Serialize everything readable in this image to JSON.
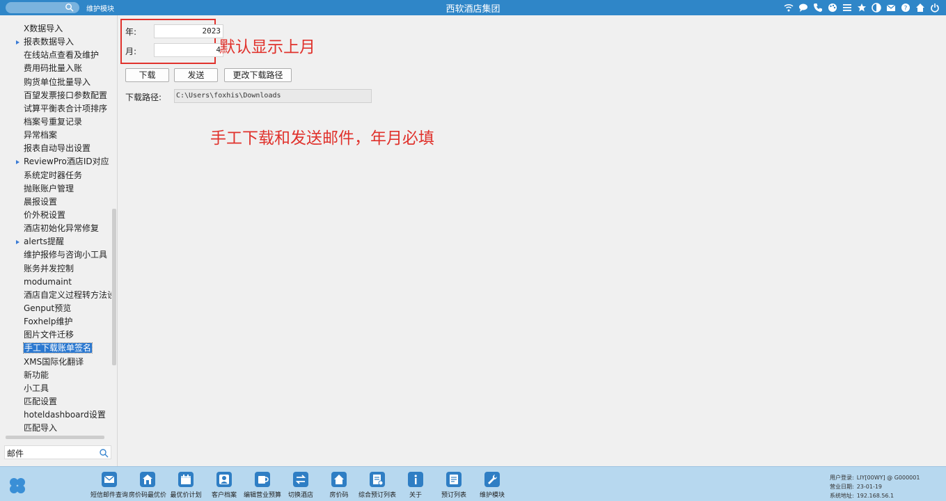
{
  "topbar": {
    "module_name": "维护模块",
    "app_title": "西软酒店集团",
    "icons": [
      "wifi-icon",
      "message-icon",
      "phone-icon",
      "palette-icon",
      "menu-icon",
      "star-icon",
      "theme-icon",
      "mail-icon",
      "help-icon",
      "home-icon",
      "power-icon"
    ]
  },
  "sidebar": {
    "items": [
      {
        "label": "X数据导入",
        "expandable": false
      },
      {
        "label": "报表数据导入",
        "expandable": true
      },
      {
        "label": "在线站点查看及维护",
        "expandable": false
      },
      {
        "label": "费用码批量入账",
        "expandable": false
      },
      {
        "label": "购货单位批量导入",
        "expandable": false
      },
      {
        "label": "百望发票接口参数配置",
        "expandable": false
      },
      {
        "label": "试算平衡表合计项排序",
        "expandable": false
      },
      {
        "label": "档案号重复记录",
        "expandable": false
      },
      {
        "label": "异常档案",
        "expandable": false
      },
      {
        "label": "报表自动导出设置",
        "expandable": false
      },
      {
        "label": "ReviewPro酒店ID对应",
        "expandable": true
      },
      {
        "label": "系统定时器任务",
        "expandable": false
      },
      {
        "label": "抛账账户管理",
        "expandable": false
      },
      {
        "label": "晨报设置",
        "expandable": false
      },
      {
        "label": "价外税设置",
        "expandable": false
      },
      {
        "label": "酒店初始化异常修复",
        "expandable": false
      },
      {
        "label": "alerts提醒",
        "expandable": true
      },
      {
        "label": "维护报修与咨询小工具",
        "expandable": false
      },
      {
        "label": "账务并发控制",
        "expandable": false
      },
      {
        "label": "modumaint",
        "expandable": false
      },
      {
        "label": "酒店自定义过程转方法设置",
        "expandable": false
      },
      {
        "label": "Genput预览",
        "expandable": false
      },
      {
        "label": "Foxhelp维护",
        "expandable": false
      },
      {
        "label": "图片文件迁移",
        "expandable": false
      },
      {
        "label": "手工下载账单签名",
        "expandable": false,
        "selected": true
      },
      {
        "label": "XMS国际化翻译",
        "expandable": false
      },
      {
        "label": "新功能",
        "expandable": false
      },
      {
        "label": "小工具",
        "expandable": false
      },
      {
        "label": "匹配设置",
        "expandable": false
      },
      {
        "label": "hoteldashboard设置",
        "expandable": false
      },
      {
        "label": "匹配导入",
        "expandable": false
      }
    ],
    "search_value": "邮件"
  },
  "form": {
    "year_label": "年:",
    "year_value": "2023",
    "month_label": "月:",
    "month_value": "4",
    "annotation_default": "默认显示上月",
    "download_button": "下载",
    "send_button": "发送",
    "change_path_button": "更改下载路径",
    "path_label": "下载路径:",
    "path_value": "C:\\Users\\foxhis\\Downloads",
    "annotation_manual": "手工下载和发送邮件，年月必填"
  },
  "taskbar": {
    "items": [
      {
        "label": "短信邮件查询",
        "icon": "mail-icon"
      },
      {
        "label": "房价码最优价",
        "icon": "house-price-icon"
      },
      {
        "label": "最优价计划",
        "icon": "calendar-icon"
      },
      {
        "label": "客户档案",
        "icon": "customer-icon"
      },
      {
        "label": "编辑营业预算",
        "icon": "cup-icon"
      },
      {
        "label": "切换酒店",
        "icon": "switch-icon"
      },
      {
        "label": "房价码",
        "icon": "home-icon"
      },
      {
        "label": "综合预订列表",
        "icon": "booking-list-icon"
      },
      {
        "label": "关于",
        "icon": "info-icon"
      },
      {
        "label": "预订列表",
        "icon": "booking-icon"
      },
      {
        "label": "维护模块",
        "icon": "wrench-icon"
      }
    ]
  },
  "status": {
    "user_label": "用户登录:",
    "user_value": "LIY[00WY] @ G000001",
    "date_label": "营业日期:",
    "date_value": "23-01-19",
    "server_label": "系统地址:",
    "server_value": "192.168.56.1"
  },
  "colors": {
    "topbar": "#2f86c8",
    "selection": "#2b78d0",
    "annotation": "#e0322c",
    "taskbar": "#b7d8ef"
  }
}
